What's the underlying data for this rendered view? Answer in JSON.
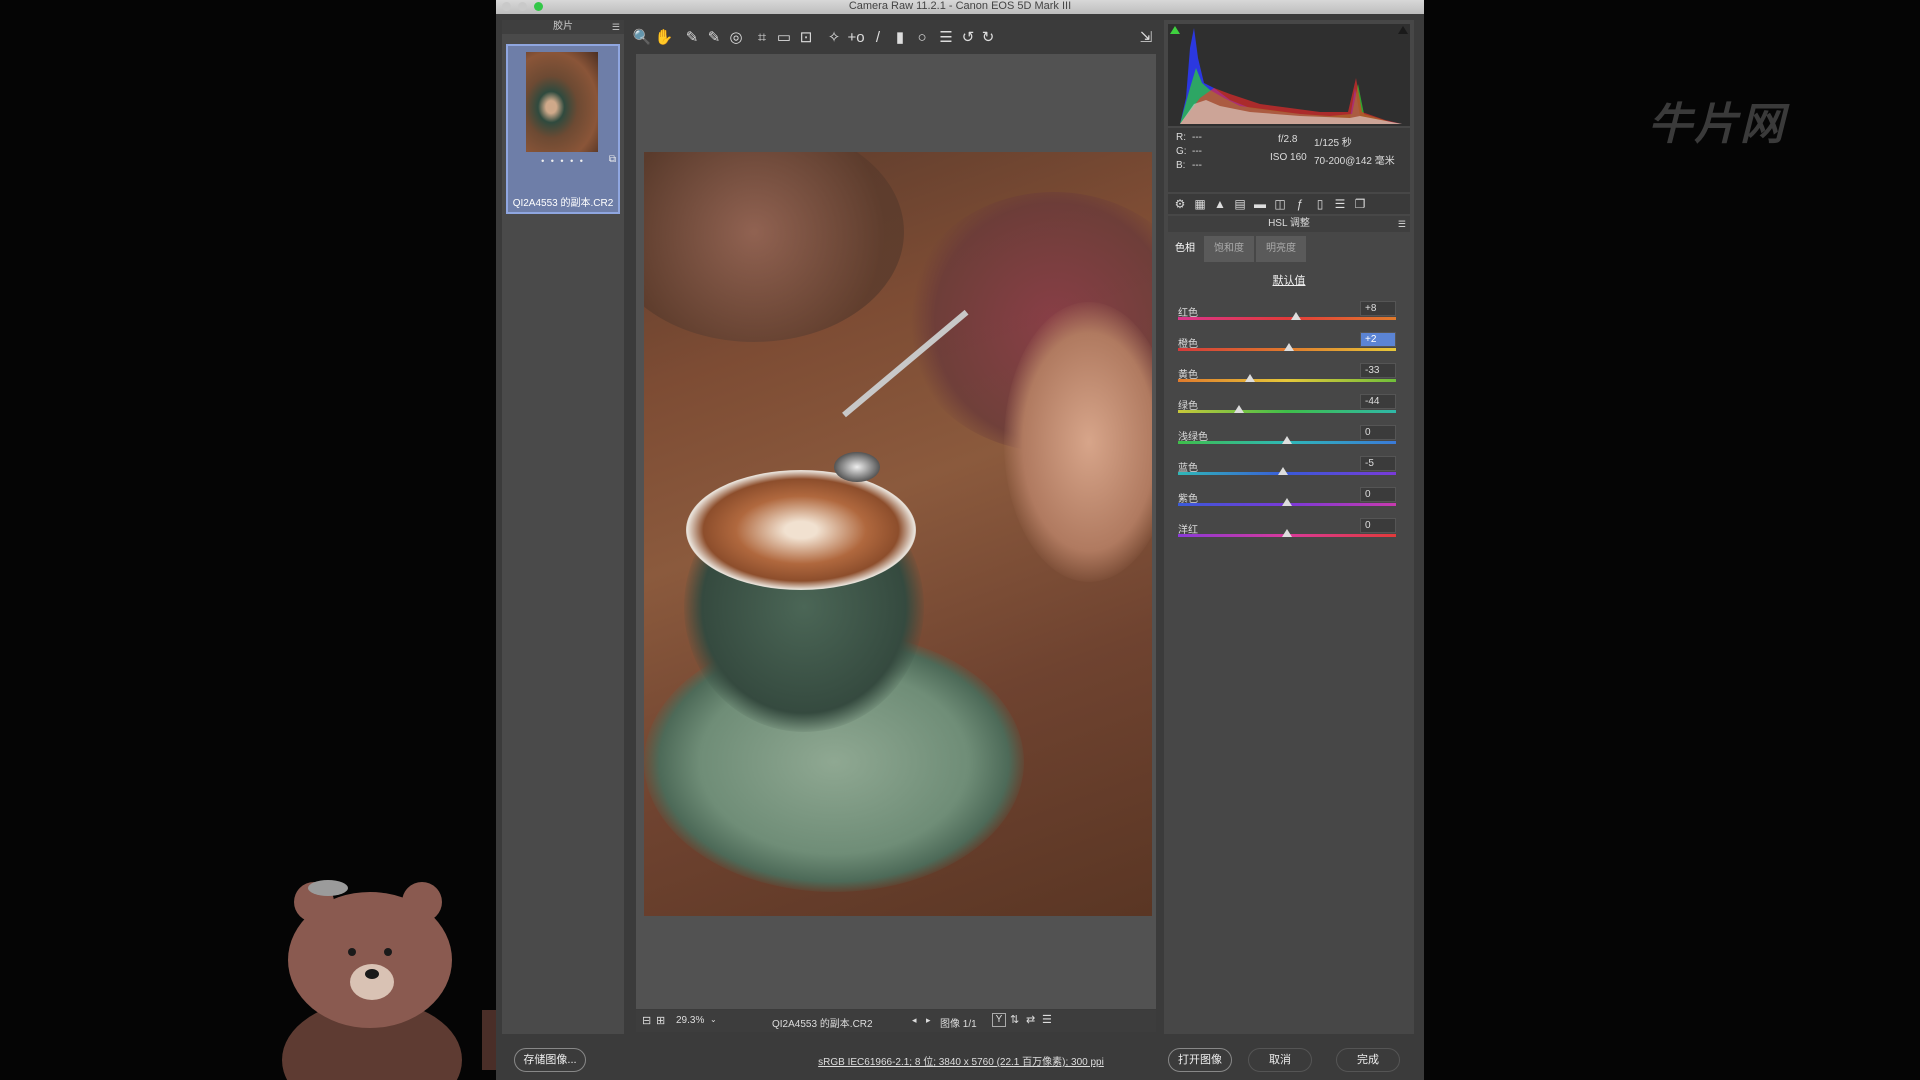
{
  "window": {
    "title": "Camera Raw 11.2.1 -  Canon EOS 5D Mark III"
  },
  "filmstrip": {
    "header": "胶片",
    "thumbnail": {
      "stars": "• • • • •",
      "filename": "QI2A4553 的副本.CR2"
    }
  },
  "toolbar": {
    "tools": [
      "zoom-tool-icon",
      "hand-tool-icon",
      "white-balance-icon",
      "color-sampler-icon",
      "target-adjust-icon",
      "crop-tool-icon",
      "straighten-icon",
      "transform-icon",
      "spot-removal-icon",
      "red-eye-icon",
      "adjustment-brush-icon",
      "graduated-filter-icon",
      "radial-filter-icon",
      "presets-list-icon",
      "rotate-left-icon",
      "rotate-right-icon"
    ],
    "glyphs": [
      "🔍",
      "✋",
      "✎",
      "✎",
      "◎",
      "⌗",
      "▭",
      "⊡",
      "✧",
      "+o",
      "/",
      "▮",
      "○",
      "☰",
      "↺",
      "↻"
    ]
  },
  "canvas_footer": {
    "zoom": "29.3%",
    "filename": "QI2A4553 的副本.CR2",
    "image_counter": "图像 1/1",
    "view_y": "Y"
  },
  "info": {
    "r_label": "R:",
    "r_val": "---",
    "g_label": "G:",
    "g_val": "---",
    "b_label": "B:",
    "b_val": "---",
    "aperture": "f/2.8",
    "shutter": "1/125 秒",
    "iso": "ISO 160",
    "lens": "70-200@142 毫米"
  },
  "panel": {
    "title": "HSL 调整",
    "subtabs": [
      "色相",
      "饱和度",
      "明亮度"
    ],
    "active_subtab": "色相",
    "default_label": "默认值",
    "sliders": [
      {
        "label": "红色",
        "value": "+8",
        "pos": 0.54,
        "gradient": "linear-gradient(90deg,#d9358c,#e23a3a,#e07a2c)"
      },
      {
        "label": "橙色",
        "value": "+2",
        "pos": 0.51,
        "gradient": "linear-gradient(90deg,#d43a3a,#e07a2c,#e6c83a)",
        "selected": true
      },
      {
        "label": "黄色",
        "value": "-33",
        "pos": 0.33,
        "gradient": "linear-gradient(90deg,#e07a2c,#e6c83a,#6fbf3a)"
      },
      {
        "label": "绿色",
        "value": "-44",
        "pos": 0.28,
        "gradient": "linear-gradient(90deg,#c8c83a,#3fbf4a,#2fb8a8)"
      },
      {
        "label": "浅绿色",
        "value": "0",
        "pos": 0.5,
        "gradient": "linear-gradient(90deg,#3fbf4a,#2fb8b8,#3a7ad9)"
      },
      {
        "label": "蓝色",
        "value": "-5",
        "pos": 0.48,
        "gradient": "linear-gradient(90deg,#2fb8b8,#3a5ad9,#7a3ad9)"
      },
      {
        "label": "紫色",
        "value": "0",
        "pos": 0.5,
        "gradient": "linear-gradient(90deg,#3a5ad9,#7a3ad9,#c83ab0)"
      },
      {
        "label": "洋红",
        "value": "0",
        "pos": 0.5,
        "gradient": "linear-gradient(90deg,#8a3ad9,#d93a9a,#e23a3a)"
      }
    ]
  },
  "bottom": {
    "save_label": "存储图像...",
    "workflow_link": "sRGB IEC61966-2.1; 8 位; 3840 x 5760 (22.1 百万像素); 300 ppi",
    "open_label": "打开图像",
    "cancel_label": "取消",
    "done_label": "完成"
  },
  "watermark": "牛片网"
}
